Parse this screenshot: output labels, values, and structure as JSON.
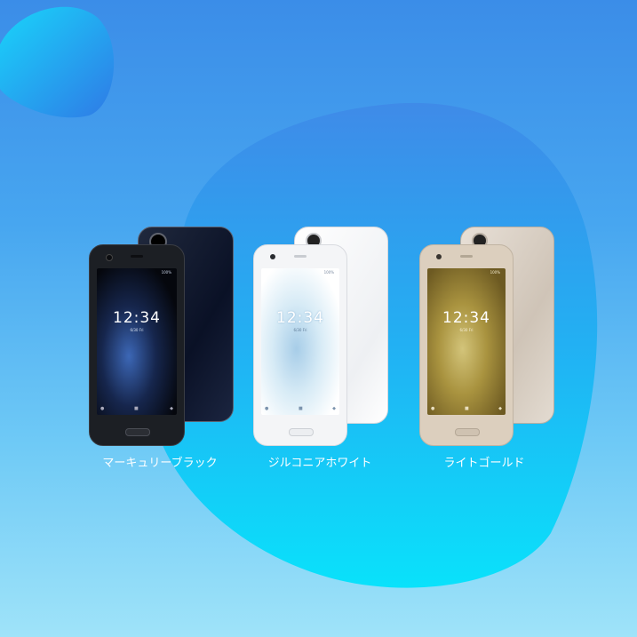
{
  "products": [
    {
      "color_name": "マーキュリーブラック",
      "clock": "12:34",
      "date": "6/30 Fri",
      "status": "100%",
      "body_color": "#1d2026",
      "back_color": "#0e1a33"
    },
    {
      "color_name": "ジルコニアホワイト",
      "clock": "12:34",
      "date": "6/30 Fri",
      "status": "100%",
      "body_color": "#f4f5f7",
      "back_color": "#f8f9fb"
    },
    {
      "color_name": "ライトゴールド",
      "clock": "12:34",
      "date": "6/30 Fri",
      "status": "100%",
      "body_color": "#d9cab8",
      "back_color": "#d8cdc0"
    }
  ]
}
